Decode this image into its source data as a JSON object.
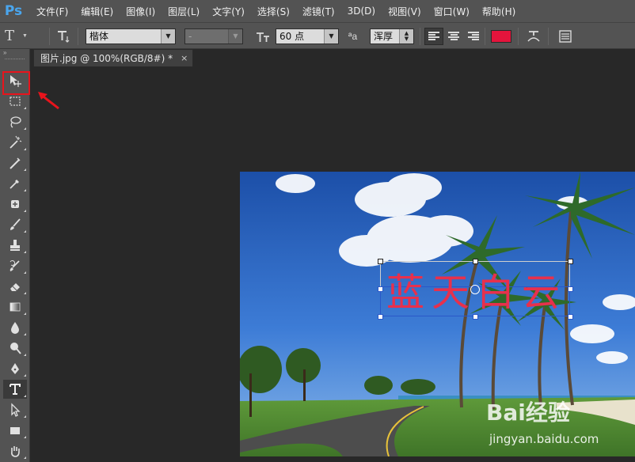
{
  "app": {
    "logo": "Ps"
  },
  "menu": [
    "文件(F)",
    "编辑(E)",
    "图像(I)",
    "图层(L)",
    "文字(Y)",
    "选择(S)",
    "滤镜(T)",
    "3D(D)",
    "视图(V)",
    "窗口(W)",
    "帮助(H)"
  ],
  "options": {
    "tool_icon": "type-tool-icon",
    "font_family": "楷体",
    "font_style": "-",
    "font_size": "60 点",
    "antialias_label": "ªa",
    "antialias_value": "浑厚",
    "text_color": "#e4143c",
    "align": "left"
  },
  "document": {
    "tab_title": "图片.jpg @ 100%(RGB/8#) *",
    "close": "×"
  },
  "canvas": {
    "overlay_text": "蓝天白云",
    "overlay_color": "#e8304c"
  },
  "tools": [
    {
      "name": "move-tool",
      "active": false,
      "highlighted": true
    },
    {
      "name": "marquee-tool"
    },
    {
      "name": "lasso-tool"
    },
    {
      "name": "magic-wand-tool"
    },
    {
      "name": "crop-tool"
    },
    {
      "name": "eyedropper-tool"
    },
    {
      "name": "healing-brush-tool"
    },
    {
      "name": "brush-tool"
    },
    {
      "name": "clone-stamp-tool"
    },
    {
      "name": "history-brush-tool"
    },
    {
      "name": "eraser-tool"
    },
    {
      "name": "gradient-tool"
    },
    {
      "name": "blur-tool"
    },
    {
      "name": "dodge-tool"
    },
    {
      "name": "pen-tool"
    },
    {
      "name": "type-tool",
      "active": true
    },
    {
      "name": "path-selection-tool"
    },
    {
      "name": "rectangle-tool"
    },
    {
      "name": "hand-tool"
    }
  ],
  "watermark": {
    "brand": "Bai经验",
    "url": "jingyan.baidu.com"
  },
  "colors": {
    "ui_bg": "#535353",
    "canvas_bg": "#282828",
    "highlight": "#e8141c"
  }
}
